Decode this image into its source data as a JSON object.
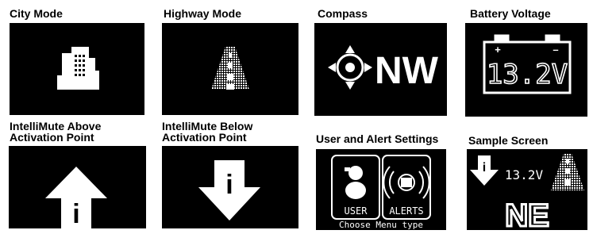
{
  "panels": [
    {
      "caption": "City Mode"
    },
    {
      "caption": "Highway Mode"
    },
    {
      "caption": "Compass",
      "heading": "NW"
    },
    {
      "caption": "Battery Voltage",
      "voltage": "13.2V",
      "plus": "+",
      "minus": "–"
    },
    {
      "caption_line1": "IntelliMute Above",
      "caption_line2": "Activation Point",
      "glyph": "i"
    },
    {
      "caption_line1": "IntelliMute Below",
      "caption_line2": "Activation Point",
      "glyph": "i"
    },
    {
      "caption": "User and Alert Settings",
      "user_label": "USER",
      "alerts_label": "ALERTS",
      "prompt": "Choose Menu type"
    },
    {
      "caption": "Sample Screen",
      "voltage": "13.2V",
      "heading": "NE",
      "glyph": "i"
    }
  ]
}
